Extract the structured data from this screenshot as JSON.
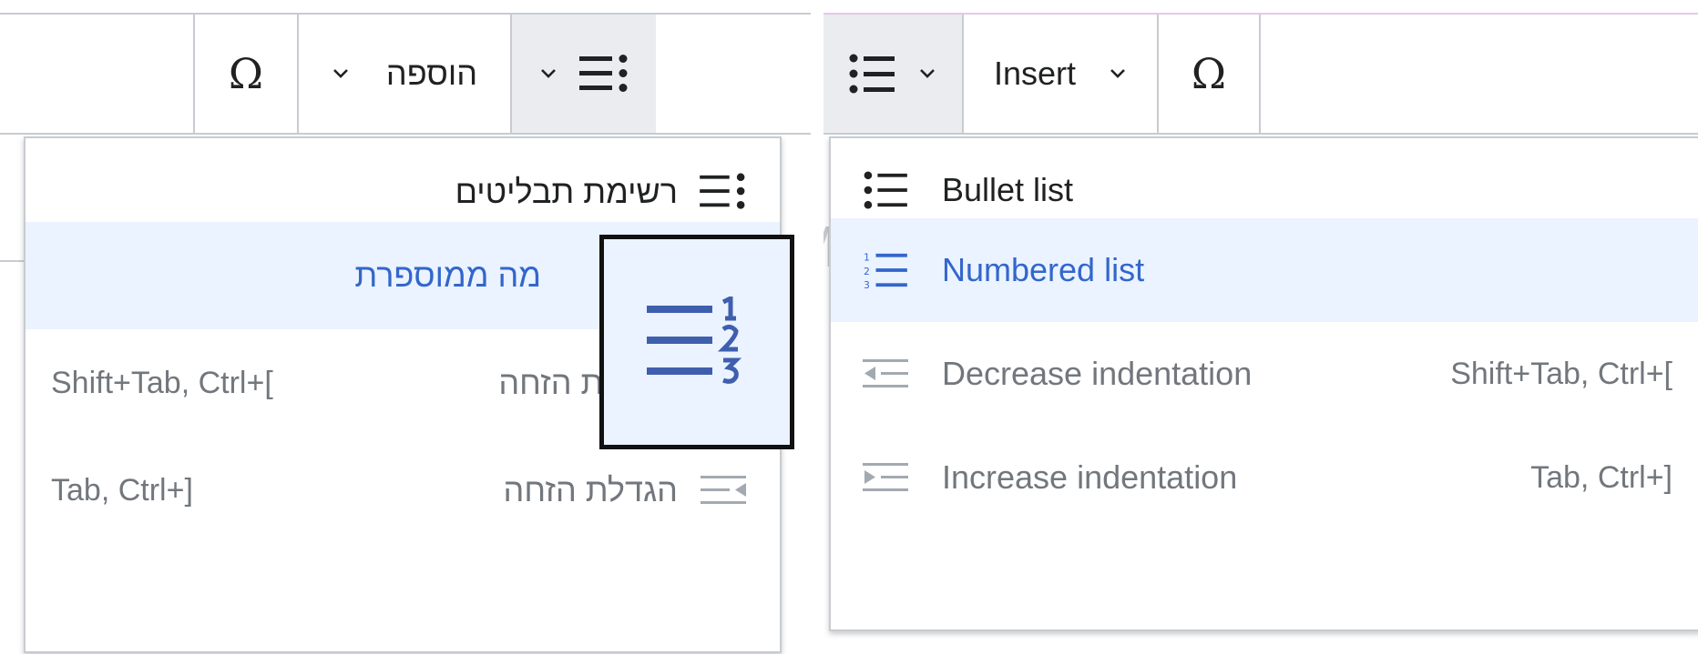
{
  "rtl_panel": {
    "toolbar": {
      "special_char_label": "Ω",
      "insert_label": "הוספה"
    },
    "menu": {
      "items": [
        {
          "label": "רשימת תבליטים",
          "shortcut": ""
        },
        {
          "label": "מה ממוספרת",
          "shortcut": ""
        },
        {
          "label": "הקטנת הזחה",
          "shortcut": "Shift+Tab, Ctrl+["
        },
        {
          "label": "הגדלת הזחה",
          "shortcut": "Tab, Ctrl+]"
        }
      ]
    }
  },
  "ltr_panel": {
    "toolbar": {
      "insert_label": "Insert",
      "special_char_label": "Ω"
    },
    "menu": {
      "items": [
        {
          "label": "Bullet list",
          "shortcut": ""
        },
        {
          "label": "Numbered list",
          "shortcut": ""
        },
        {
          "label": "Decrease indentation",
          "shortcut": "Shift+Tab, Ctrl+["
        },
        {
          "label": "Increase indentation",
          "shortcut": "Tab, Ctrl+]"
        }
      ]
    }
  },
  "colors": {
    "accent": "#3366cc",
    "highlight_bg": "#eaf3ff",
    "active_button_bg": "#eaecf0",
    "border": "#c8ccd1",
    "disabled_text": "#72777d",
    "text": "#202122"
  },
  "icons": {
    "list_button": "bullet-list-rtl-icon",
    "menu_rtl": [
      "bullet-list-rtl-icon",
      "numbered-list-icon",
      "outdent-icon",
      "indent-icon"
    ],
    "menu_ltr": [
      "bullet-list-icon",
      "numbered-list-icon",
      "outdent-icon",
      "indent-icon"
    ],
    "callout": "numbered-list-rtl-icon-zoomed"
  }
}
